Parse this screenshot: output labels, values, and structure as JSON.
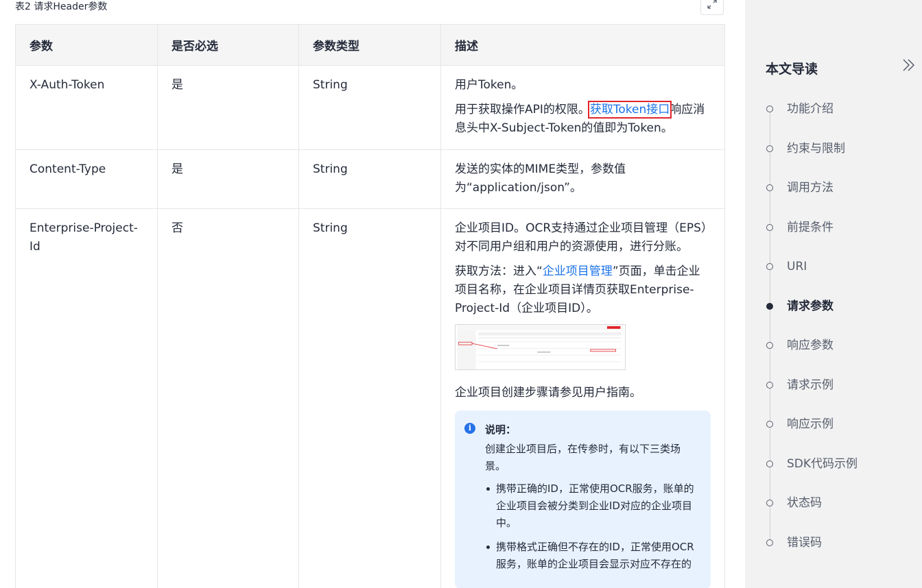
{
  "caption": "表2 请求Header参数",
  "table": {
    "headers": [
      "参数",
      "是否必选",
      "参数类型",
      "描述"
    ],
    "rows": [
      {
        "name": "X-Auth-Token",
        "required": "是",
        "type": "String",
        "desc_p1": "用户Token。",
        "desc_p2_before": "用于获取操作API的权限。",
        "desc_p2_link": "获取Token接口",
        "desc_p2_after": "响应消息头中X-Subject-Token的值即为Token。"
      },
      {
        "name": "Content-Type",
        "required": "是",
        "type": "String",
        "desc_p1": "发送的实体的MIME类型，参数值为“application/json”。"
      },
      {
        "name": "Enterprise-Project-Id",
        "required": "否",
        "type": "String",
        "desc_p1": "企业项目ID。OCR支持通过企业项目管理（EPS）对不同用户组和用户的资源使用，进行分账。",
        "desc_p2_before": "获取方法：进入“",
        "desc_p2_link": "企业项目管理",
        "desc_p2_after": "”页面，单击企业项目名称，在企业项目详情页获取Enterprise-Project-Id（企业项目ID）。",
        "desc_p3": "企业项目创建步骤请参见用户指南。",
        "note_title": "说明：",
        "note_text": "创建企业项目后，在传参时，有以下三类场景。",
        "note_items": [
          "携带正确的ID，正常使用OCR服务，账单的企业项目会被分类到企业ID对应的企业项目中。",
          "携带格式正确但不存在的ID，正常使用OCR服务，账单的企业项目会显示对应不存在的"
        ]
      }
    ]
  },
  "sidebar": {
    "title": "本文导读",
    "items": [
      "功能介绍",
      "约束与限制",
      "调用方法",
      "前提条件",
      "URI",
      "请求参数",
      "响应参数",
      "请求示例",
      "响应示例",
      "SDK代码示例",
      "状态码",
      "错误码"
    ],
    "active": "请求参数"
  },
  "colors": {
    "link": "#1a73e8",
    "highlight_box": "#e0242a",
    "note_bg": "#e8f2ff",
    "sidebar_bg": "#f2f2f2"
  },
  "icons": [
    "expand-icon",
    "info-icon",
    "double-chevron-right-icon"
  ]
}
